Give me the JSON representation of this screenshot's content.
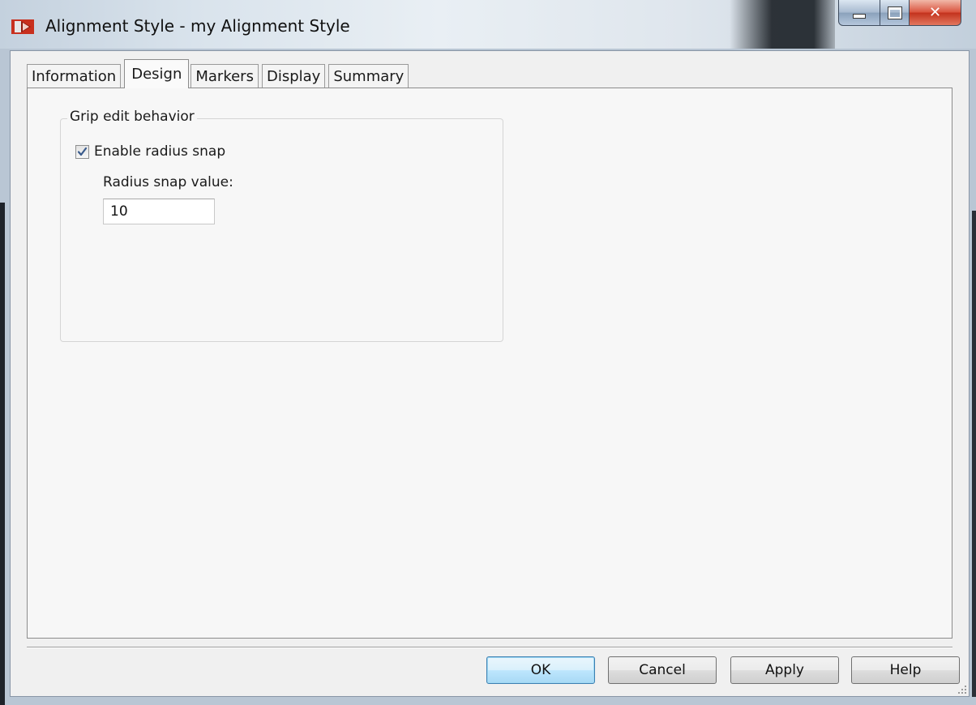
{
  "window": {
    "title": "Alignment Style - my Alignment Style"
  },
  "tabs": [
    {
      "label": "Information",
      "active": false
    },
    {
      "label": "Design",
      "active": true
    },
    {
      "label": "Markers",
      "active": false
    },
    {
      "label": "Display",
      "active": false
    },
    {
      "label": "Summary",
      "active": false
    }
  ],
  "design": {
    "group_title": "Grip edit behavior",
    "enable_radius_snap": {
      "label": "Enable radius snap",
      "checked": true
    },
    "radius_snap_label": "Radius snap value:",
    "radius_snap_value": "10"
  },
  "buttons": {
    "ok": "OK",
    "cancel": "Cancel",
    "apply": "Apply",
    "help": "Help"
  },
  "colors": {
    "app_icon_red": "#c8301e",
    "close_button": "#c9452f",
    "default_button_border": "#3c7fb1"
  },
  "icons": {
    "app": "app-logo-icon",
    "minimize": "minimize-icon",
    "maximize": "maximize-icon",
    "close": "close-icon",
    "checkmark": "checkmark-icon",
    "resize": "resize-grip-icon"
  }
}
